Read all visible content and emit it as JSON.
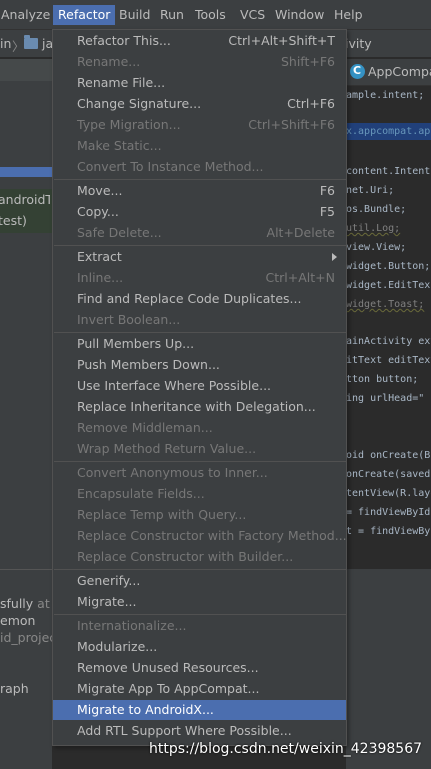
{
  "menubar": {
    "items": [
      "Analyze",
      "Refactor",
      "Build",
      "Run",
      "Tools",
      "VCS",
      "Window",
      "Help"
    ]
  },
  "navbar": {
    "crumb_left": "in",
    "crumb_folder": "ja"
  },
  "left_panel": {
    "fragments": [
      "androidT",
      "test)",
      "sfully",
      "at 2",
      "emon",
      "id_projec",
      "raph"
    ]
  },
  "editor": {
    "tab_label": "AppCompa",
    "header_fragment": "ivity",
    "lines": [
      "ample.intent;",
      "x.appcompat.app",
      "content.Intent",
      "net.Uri;",
      "os.Bundle;",
      "util.Log;",
      "view.View;",
      "widget.Button;",
      "widget.EditTex",
      "widget.Toast;",
      "ainActivity ext",
      "itText editText",
      "tton button;",
      "ing urlHead=\"",
      "oid onCreate(B",
      "onCreate(savedI",
      "tentView(R.layo",
      "= findViewById",
      "t = findViewBy"
    ]
  },
  "menu": {
    "items": [
      {
        "label": "Refactor This...",
        "shortcut": "Ctrl+Alt+Shift+T",
        "disabled": false
      },
      {
        "label": "Rename...",
        "shortcut": "Shift+F6",
        "disabled": true
      },
      {
        "label": "Rename File...",
        "shortcut": "",
        "disabled": false
      },
      {
        "label": "Change Signature...",
        "shortcut": "Ctrl+F6",
        "disabled": false
      },
      {
        "label": "Type Migration...",
        "shortcut": "Ctrl+Shift+F6",
        "disabled": true
      },
      {
        "label": "Make Static...",
        "shortcut": "",
        "disabled": true
      },
      {
        "label": "Convert To Instance Method...",
        "shortcut": "",
        "disabled": true
      },
      {
        "label": "Move...",
        "shortcut": "F6",
        "disabled": false
      },
      {
        "label": "Copy...",
        "shortcut": "F5",
        "disabled": false
      },
      {
        "label": "Safe Delete...",
        "shortcut": "Alt+Delete",
        "disabled": true
      },
      {
        "label": "Extract",
        "shortcut": "",
        "disabled": false
      },
      {
        "label": "Inline...",
        "shortcut": "Ctrl+Alt+N",
        "disabled": true
      },
      {
        "label": "Find and Replace Code Duplicates...",
        "shortcut": "",
        "disabled": false
      },
      {
        "label": "Invert Boolean...",
        "shortcut": "",
        "disabled": true
      },
      {
        "label": "Pull Members Up...",
        "shortcut": "",
        "disabled": false
      },
      {
        "label": "Push Members Down...",
        "shortcut": "",
        "disabled": false
      },
      {
        "label": "Use Interface Where Possible...",
        "shortcut": "",
        "disabled": false
      },
      {
        "label": "Replace Inheritance with Delegation...",
        "shortcut": "",
        "disabled": false
      },
      {
        "label": "Remove Middleman...",
        "shortcut": "",
        "disabled": true
      },
      {
        "label": "Wrap Method Return Value...",
        "shortcut": "",
        "disabled": true
      },
      {
        "label": "Convert Anonymous to Inner...",
        "shortcut": "",
        "disabled": true
      },
      {
        "label": "Encapsulate Fields...",
        "shortcut": "",
        "disabled": true
      },
      {
        "label": "Replace Temp with Query...",
        "shortcut": "",
        "disabled": true
      },
      {
        "label": "Replace Constructor with Factory Method...",
        "shortcut": "",
        "disabled": true
      },
      {
        "label": "Replace Constructor with Builder...",
        "shortcut": "",
        "disabled": true
      },
      {
        "label": "Generify...",
        "shortcut": "",
        "disabled": false
      },
      {
        "label": "Migrate...",
        "shortcut": "",
        "disabled": false
      },
      {
        "label": "Internationalize...",
        "shortcut": "",
        "disabled": true
      },
      {
        "label": "Modularize...",
        "shortcut": "",
        "disabled": false
      },
      {
        "label": "Remove Unused Resources...",
        "shortcut": "",
        "disabled": false
      },
      {
        "label": "Migrate App To AppCompat...",
        "shortcut": "",
        "disabled": false
      },
      {
        "label": "Migrate to AndroidX...",
        "shortcut": "",
        "disabled": false,
        "selected": true
      },
      {
        "label": "Add RTL Support Where Possible...",
        "shortcut": "",
        "disabled": false
      }
    ]
  },
  "watermark": "https://blog.csdn.net/weixin_42398567",
  "colors": {
    "accent": "#4b6eaf",
    "menu_bg": "#3c3f41",
    "editor_bg": "#2b2b2b",
    "disabled_text": "#777777"
  }
}
